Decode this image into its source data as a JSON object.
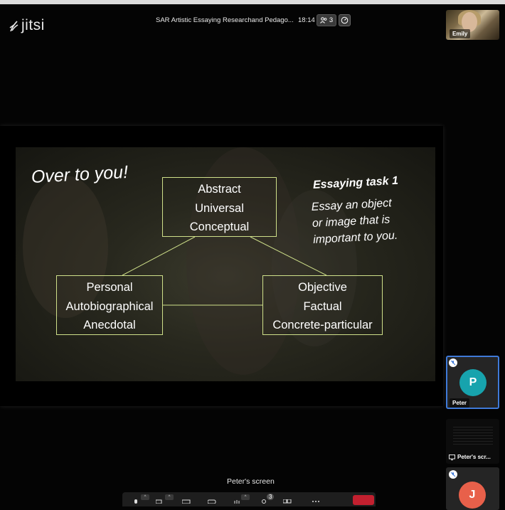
{
  "app": {
    "logo_text": "jitsi"
  },
  "header": {
    "meeting_title": "SAR Artistic Essaying Researchand Pedago...",
    "timer": "18:14",
    "participant_count": "3"
  },
  "self_view": {
    "name": "Emily"
  },
  "slide": {
    "heading": "Over to you!",
    "task_title": "Essaying task 1",
    "task_lines": [
      "Essay an object",
      "or image that is",
      "important to you."
    ],
    "top_box": [
      "Abstract",
      "Universal",
      "Conceptual"
    ],
    "left_box": [
      "Personal",
      "Autobiographical",
      "Anecdotal"
    ],
    "right_box": [
      "Objective",
      "Factual",
      "Concrete-particular"
    ]
  },
  "filmstrip": {
    "peter": {
      "initial": "P",
      "name": "Peter",
      "avatar_color": "#17a3ad"
    },
    "screen_share": {
      "label": "Peter's scr..."
    },
    "j_tile": {
      "initial": "J",
      "avatar_color": "#e8604a"
    }
  },
  "stage_label": "Peter's screen",
  "toolbar": {
    "badge_count": "3",
    "hangup_color": "#c2202f"
  },
  "colors": {
    "accent": "#3f7ad8",
    "box_border": "#cfe08a"
  }
}
